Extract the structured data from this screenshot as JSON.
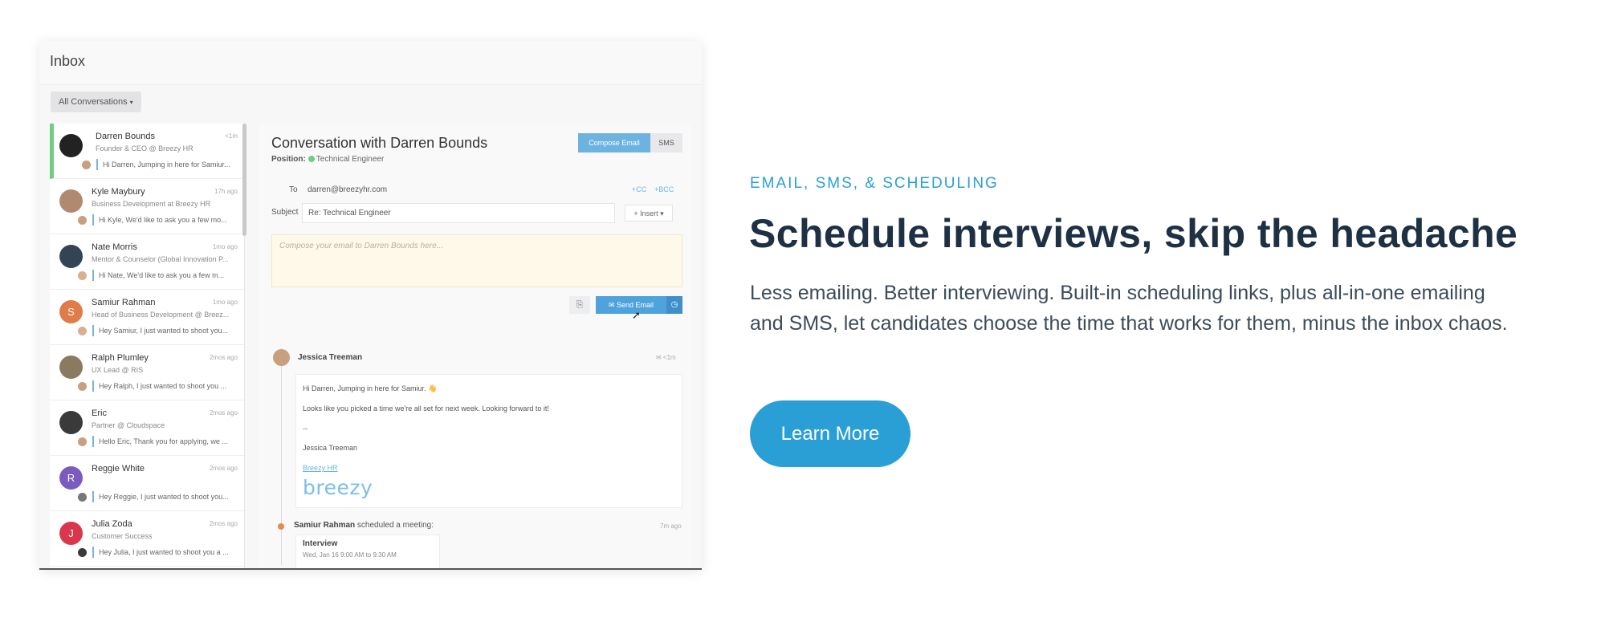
{
  "inbox": {
    "title": "Inbox",
    "filter": {
      "label": "All Conversations",
      "caret": "▾"
    },
    "conversations": [
      {
        "name": "Darren Bounds",
        "role": "Founder & CEO @ Breezy HR",
        "time": "<1m",
        "snippet": "Hi Darren, Jumping in here for Samiur...",
        "avatar_initial": "",
        "avatar_color": "#222222",
        "mini_color": "#c8a080"
      },
      {
        "name": "Kyle Maybury",
        "role": "Business Development at Breezy HR",
        "time": "17h ago",
        "snippet": "Hi Kyle, We'd like to ask you a few mo...",
        "avatar_initial": "",
        "avatar_color": "#b08a70",
        "mini_color": "#c8a080"
      },
      {
        "name": "Nate Morris",
        "role": "Mentor & Counselor (Global Innovation P...",
        "time": "1mo ago",
        "snippet": "Hi Nate, We'd like to ask you a few m...",
        "avatar_initial": "",
        "avatar_color": "#334455",
        "mini_color": "#d8b090"
      },
      {
        "name": "Samiur Rahman",
        "role": "Head of Business Development @ Breez...",
        "time": "1mo ago",
        "snippet": "Hey Samiur, I just wanted to shoot you...",
        "avatar_initial": "S",
        "avatar_color": "#e07b4a",
        "mini_color": "#d8b090"
      },
      {
        "name": "Ralph Plumley",
        "role": "UX Lead @ RIS",
        "time": "2mos ago",
        "snippet": "Hey Ralph, I just wanted to shoot you ...",
        "avatar_initial": "",
        "avatar_color": "#8a7a60",
        "mini_color": "#c8a080"
      },
      {
        "name": "Eric",
        "role": "Partner @ Cloudspace",
        "time": "2mos ago",
        "snippet": "Hello Eric, Thank you for applying, we ...",
        "avatar_initial": "",
        "avatar_color": "#3a3a3a",
        "mini_color": "#c8a080"
      },
      {
        "name": "Reggie White",
        "role": "",
        "time": "2mos ago",
        "snippet": "Hey Reggie, I just wanted to shoot you...",
        "avatar_initial": "R",
        "avatar_color": "#7a5cc0",
        "mini_color": "#777777"
      },
      {
        "name": "Julia Zoda",
        "role": "Customer Success",
        "time": "2mos ago",
        "snippet": "Hey Julia, I just wanted to shoot you a ...",
        "avatar_initial": "J",
        "avatar_color": "#d9374b",
        "mini_color": "#3a3a3a"
      }
    ]
  },
  "detail": {
    "title": "Conversation with Darren Bounds",
    "position_label": "Position:",
    "position_value": "Technical Engineer",
    "compose_email_label": "Compose Email",
    "sms_label": "SMS",
    "to_label": "To",
    "to_value": "darren@breezyhr.com",
    "cc_label": "+CC",
    "bcc_label": "+BCC",
    "subject_label": "Subject",
    "subject_value": "Re: Technical Engineer",
    "insert_label": "+ Insert ▾",
    "compose_placeholder": "Compose your email to Darren Bounds here...",
    "send_label": "✉ Send Email",
    "message": {
      "author": "Jessica Treeman",
      "meta": "✉ <1m",
      "greeting": "Hi Darren, Jumping in here for Samiur. 👋",
      "body": "Looks like you picked a time we're all set for next week. Looking forward to it!",
      "dash": "--",
      "signature_name": "Jessica Treeman",
      "signature_link": "Breezy HR",
      "logo_text": "breezy"
    },
    "event": {
      "actor": "Samiur Rahman",
      "action": "scheduled a meeting:",
      "time": "7m ago",
      "title": "Interview",
      "sub": "Wed, Jan 16 9:00 AM to 9:30 AM"
    }
  },
  "marketing": {
    "eyebrow": "EMAIL, SMS, & SCHEDULING",
    "headline": "Schedule interviews, skip the headache",
    "body": "Less emailing. Better interviewing. Built-in scheduling links, plus all-in-one emailing and SMS, let candidates choose the time that works for them, minus the inbox chaos.",
    "cta": "Learn More",
    "accent_color": "#2a9fd6",
    "heading_color": "#1d3044"
  }
}
